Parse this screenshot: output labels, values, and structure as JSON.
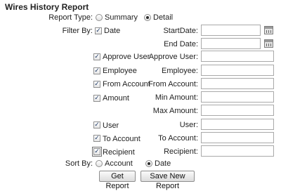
{
  "title": "Wires History Report",
  "report_type": {
    "label": "Report Type:",
    "options": [
      "Summary",
      "Detail"
    ],
    "selected": "Detail"
  },
  "filter": {
    "label": "Filter By:",
    "checks": {
      "date": {
        "label": "Date",
        "checked": true
      },
      "approve_user": {
        "label": "Approve User",
        "checked": true
      },
      "employee": {
        "label": "Employee",
        "checked": true
      },
      "from_account": {
        "label": "From Account",
        "checked": true
      },
      "amount": {
        "label": "Amount",
        "checked": true
      },
      "user": {
        "label": "User",
        "checked": true
      },
      "to_account": {
        "label": "To Account",
        "checked": true
      },
      "recipient": {
        "label": "Recipient",
        "checked": true
      }
    }
  },
  "fields": {
    "start_date": {
      "label": "StartDate:",
      "value": ""
    },
    "end_date": {
      "label": "End Date:",
      "value": ""
    },
    "approve_user": {
      "label": "Approve User:",
      "value": ""
    },
    "employee": {
      "label": "Employee:",
      "value": ""
    },
    "from_account": {
      "label": "From Account:",
      "value": ""
    },
    "min_amount": {
      "label": "Min Amount:",
      "value": ""
    },
    "max_amount": {
      "label": "Max Amount:",
      "value": ""
    },
    "user": {
      "label": "User:",
      "value": ""
    },
    "to_account": {
      "label": "To Account:",
      "value": ""
    },
    "recipient": {
      "label": "Recipient:",
      "value": ""
    }
  },
  "sort": {
    "label": "Sort By:",
    "options": [
      "Account",
      "Date"
    ],
    "selected": "Date"
  },
  "buttons": {
    "get_report": "Get Report",
    "save_new_report": "Save New Report"
  },
  "icons": {
    "calendar": "calendar-icon",
    "check": "checkmark"
  }
}
